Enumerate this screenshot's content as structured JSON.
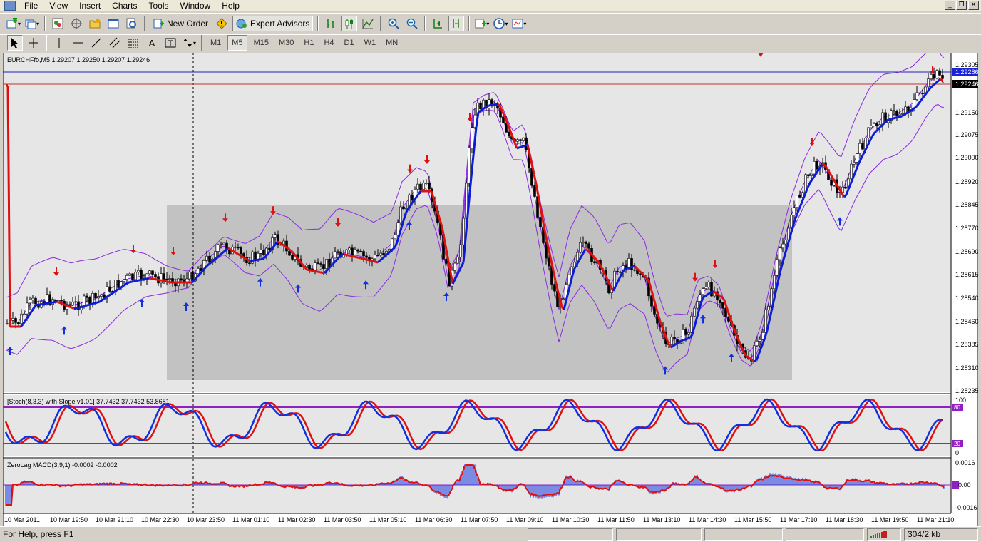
{
  "menu": {
    "items": [
      "File",
      "View",
      "Insert",
      "Charts",
      "Tools",
      "Window",
      "Help"
    ]
  },
  "toolbar": {
    "new_order": "New Order",
    "expert_advisors": "Expert Advisors"
  },
  "timeframes": [
    "M1",
    "M5",
    "M15",
    "M30",
    "H1",
    "H4",
    "D1",
    "W1",
    "MN"
  ],
  "active_timeframe": "M5",
  "chart": {
    "header": "EURCHFfo,M5  1.29207 1.29250 1.29207 1.29246",
    "price_labels": [
      "1.29305",
      "1.29286",
      "1.29246",
      "1.29150",
      "1.29075",
      "1.29000",
      "1.28920",
      "1.28845",
      "1.28770",
      "1.28690",
      "1.28615",
      "1.28540",
      "1.28460",
      "1.28385",
      "1.28310",
      "1.28235"
    ],
    "current_price": "1.29246",
    "ask_price": "1.29286",
    "time_labels": [
      "10 Mar 2011",
      "10 Mar 19:50",
      "10 Mar 21:10",
      "10 Mar 22:30",
      "10 Mar 23:50",
      "11 Mar 01:10",
      "11 Mar 02:30",
      "11 Mar 03:50",
      "11 Mar 05:10",
      "11 Mar 06:30",
      "11 Mar 07:50",
      "11 Mar 09:10",
      "11 Mar 10:30",
      "11 Mar 11:50",
      "11 Mar 13:10",
      "11 Mar 14:30",
      "11 Mar 15:50",
      "11 Mar 17:10",
      "11 Mar 18:30",
      "11 Mar 19:50",
      "11 Mar 21:10"
    ],
    "colors": {
      "bullish_ma": "#0a1ad8",
      "bearish_ma": "#e01010",
      "band": "#8a2be2",
      "zone": "#c0c0c0"
    }
  },
  "stoch": {
    "header": "[Stoch(8,3,3) with Slope v1.01] 37.7432 37.7432 53.8681",
    "levels": [
      "100",
      "80",
      "20",
      "0"
    ]
  },
  "macd": {
    "header": "ZeroLag MACD(3,9,1) -0.0002 -0.0002",
    "levels": [
      "0.0016",
      "0.00",
      "-0.0016"
    ]
  },
  "status": {
    "help": "For Help, press F1",
    "traffic": "304/2 kb"
  }
}
